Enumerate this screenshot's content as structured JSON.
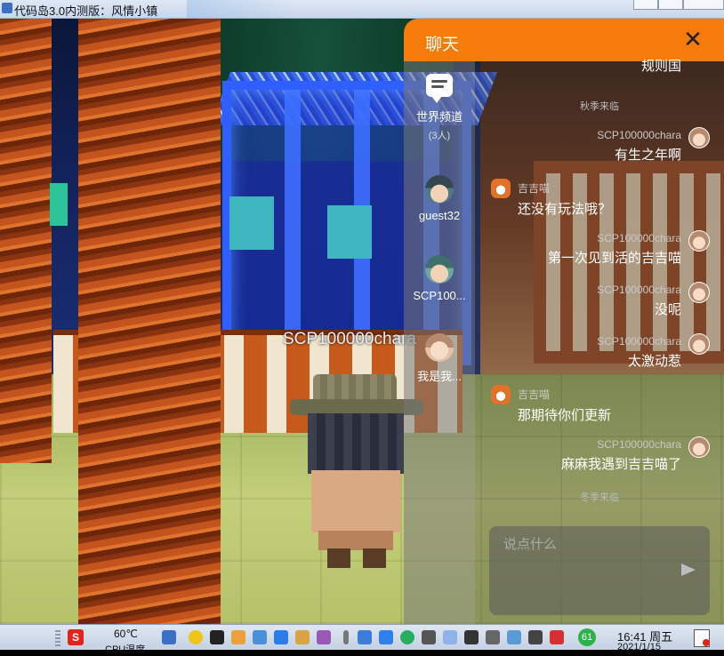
{
  "window": {
    "title": "代码岛3.0内测版：风情小镇"
  },
  "scene": {
    "player_name": "SCP100000chara"
  },
  "chat": {
    "title": "聊天",
    "close_label": "✕",
    "channels": [
      {
        "id": "world",
        "name": "世界频道",
        "sub": "(3人)",
        "icon": "chat-bubble-icon"
      },
      {
        "id": "guest32",
        "name": "guest32",
        "icon": "avatar"
      },
      {
        "id": "scp",
        "name": "SCP100...",
        "icon": "avatar"
      },
      {
        "id": "me",
        "name": "我是我...",
        "icon": "avatar"
      }
    ],
    "truncated_top": "规则国",
    "season_autumn": "秋季来临",
    "season_winter": "冬季来临",
    "messages": [
      {
        "side": "right",
        "sender": "SCP100000chara",
        "text": "有生之年啊"
      },
      {
        "side": "left",
        "sender": "吉吉喵",
        "text": "还没有玩法哦？"
      },
      {
        "side": "right",
        "sender": "SCP100000chara",
        "text": "第一次见到活的吉吉喵"
      },
      {
        "side": "right",
        "sender": "SCP100000chara",
        "text": "没呢"
      },
      {
        "side": "right",
        "sender": "SCP100000chara",
        "text": "太激动惹"
      },
      {
        "side": "left",
        "sender": "吉吉喵",
        "text": "那期待你们更新"
      },
      {
        "side": "right",
        "sender": "SCP100000chara",
        "text": "麻麻我遇到吉吉喵了"
      }
    ],
    "input": {
      "placeholder": "说点什么",
      "value": ""
    },
    "accent_color": "#f57b0a"
  },
  "taskbar": {
    "app_badge": "S",
    "cpu_temp": "60℃",
    "cpu_label": "CPU温度",
    "battery": "61",
    "time": "16:41 周五",
    "date": "2021/1/15"
  }
}
